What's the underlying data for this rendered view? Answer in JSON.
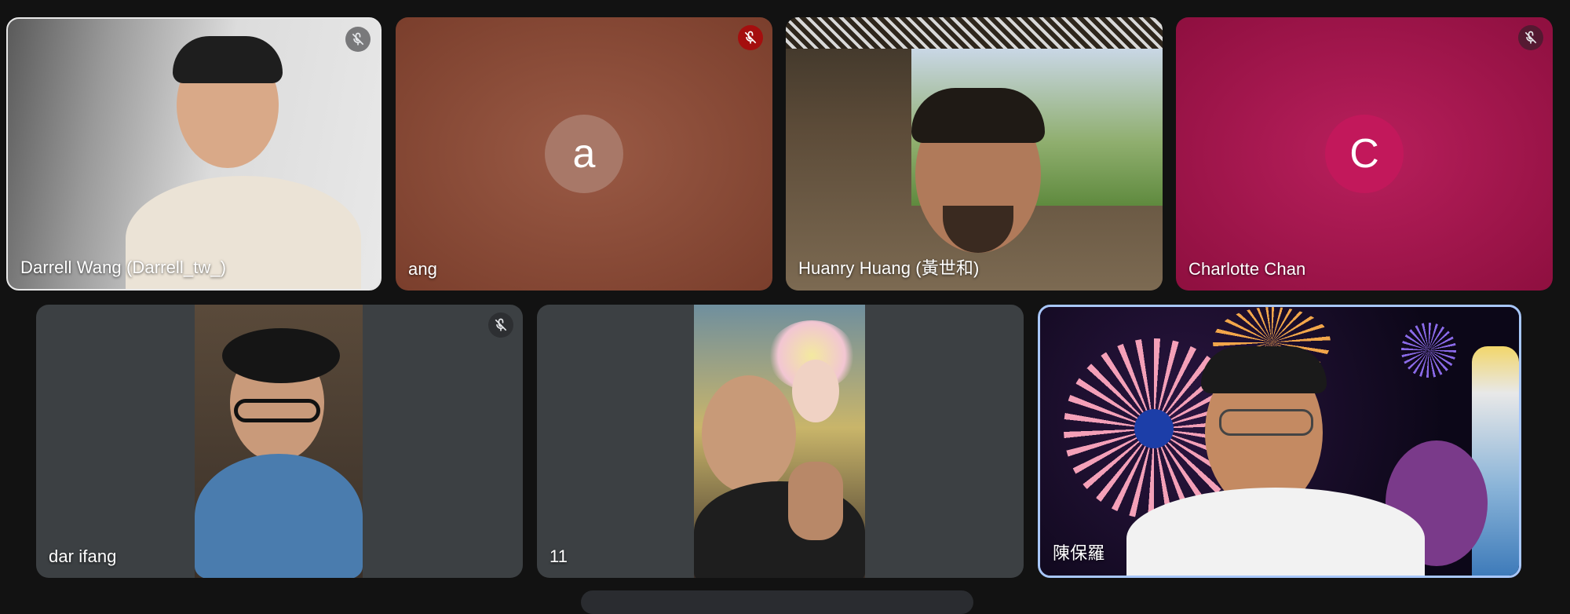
{
  "participants": [
    {
      "name": "Darrell Wang (Darrell_tw_)",
      "muted": true,
      "camera": "on"
    },
    {
      "name": "ang",
      "muted": true,
      "camera": "off",
      "avatar_letter": "a",
      "tile_color": "#8a4a35",
      "avatar_color": "#a86a55"
    },
    {
      "name": "Huanry Huang (黃世和)",
      "muted": false,
      "camera": "on"
    },
    {
      "name": "Charlotte Chan",
      "muted": true,
      "camera": "off",
      "avatar_letter": "C",
      "tile_color": "#a8174f",
      "avatar_color": "#c2185b"
    },
    {
      "name": "dar ifang",
      "muted": true,
      "camera": "on"
    },
    {
      "name": "11",
      "muted": false,
      "camera": "on"
    },
    {
      "name": "陳保羅",
      "muted": false,
      "camera": "on",
      "active_speaker": true
    }
  ],
  "icons": {
    "muted": "mic-off-icon"
  },
  "colors": {
    "background": "#121212",
    "tile_empty": "#3c4043",
    "speaker_border": "#a8c7fa",
    "mute_red": "#a50e0e"
  }
}
